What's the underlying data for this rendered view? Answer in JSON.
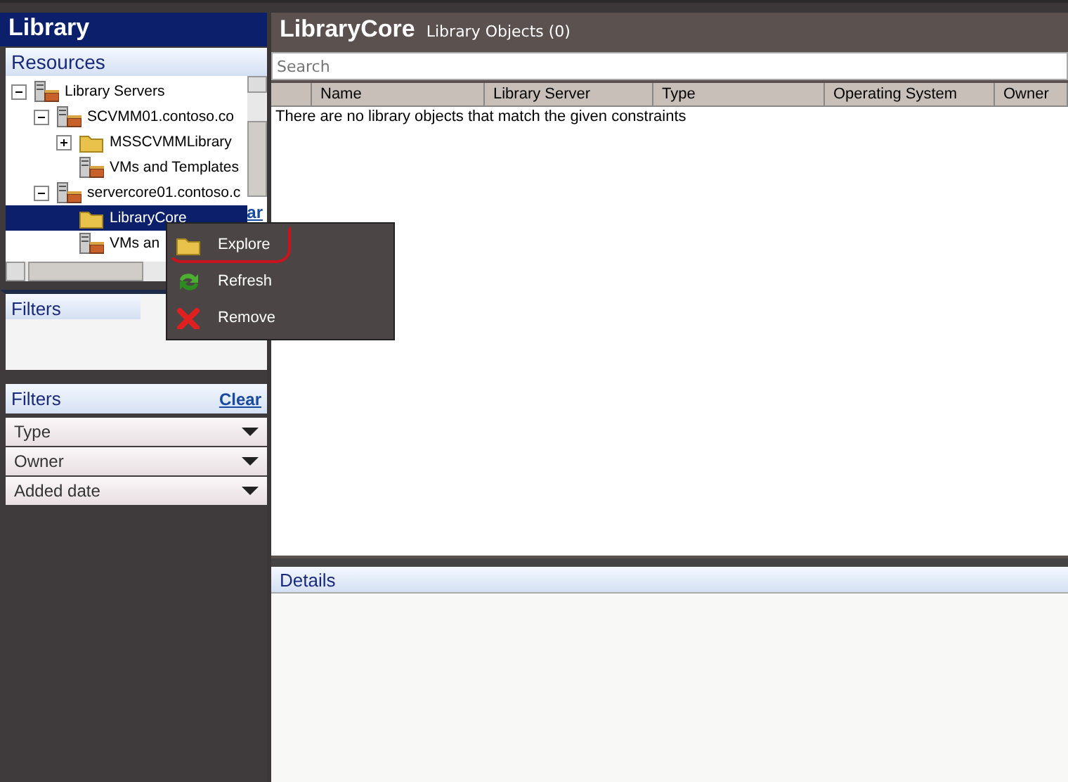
{
  "sidebar": {
    "title": "Library",
    "resources": {
      "title": "Resources",
      "tree": [
        {
          "label": "Library Servers",
          "kind": "server",
          "expanded": true,
          "selected": false,
          "children": [
            {
              "label": "SCVMM01.contoso.co",
              "kind": "server",
              "expanded": true,
              "selected": false,
              "children": [
                {
                  "label": "MSSCVMMLibrary",
                  "kind": "folder",
                  "expanded": false,
                  "selected": false
                },
                {
                  "label": "VMs and Templates",
                  "kind": "server",
                  "selected": false
                }
              ]
            },
            {
              "label": "servercore01.contoso.c",
              "kind": "server",
              "expanded": true,
              "selected": false,
              "children": [
                {
                  "label": "LibraryCore",
                  "kind": "folder",
                  "selected": true
                },
                {
                  "label": "VMs an",
                  "kind": "server",
                  "selected": false
                }
              ]
            }
          ]
        }
      ],
      "hidden_link": "ar"
    },
    "filters_upper": {
      "title": "Filters"
    },
    "filters": {
      "title": "Filters",
      "clear": "Clear",
      "dropdowns": [
        "Type",
        "Owner",
        "Added date"
      ]
    }
  },
  "main": {
    "title": "LibraryCore",
    "subtitle": "Library Objects (0)",
    "search": {
      "placeholder": "Search"
    },
    "table": {
      "columns": [
        "",
        "Name",
        "Library Server",
        "Type",
        "Operating System",
        "Owner"
      ],
      "empty_message": "There are no library objects that match the given constraints"
    },
    "details": {
      "title": "Details"
    }
  },
  "context_menu": {
    "items": [
      {
        "label": "Explore",
        "kind": "folder",
        "highlighted": true
      },
      {
        "label": "Refresh",
        "kind": "refresh",
        "highlighted": false
      },
      {
        "label": "Remove",
        "kind": "remove",
        "highlighted": false
      }
    ]
  }
}
